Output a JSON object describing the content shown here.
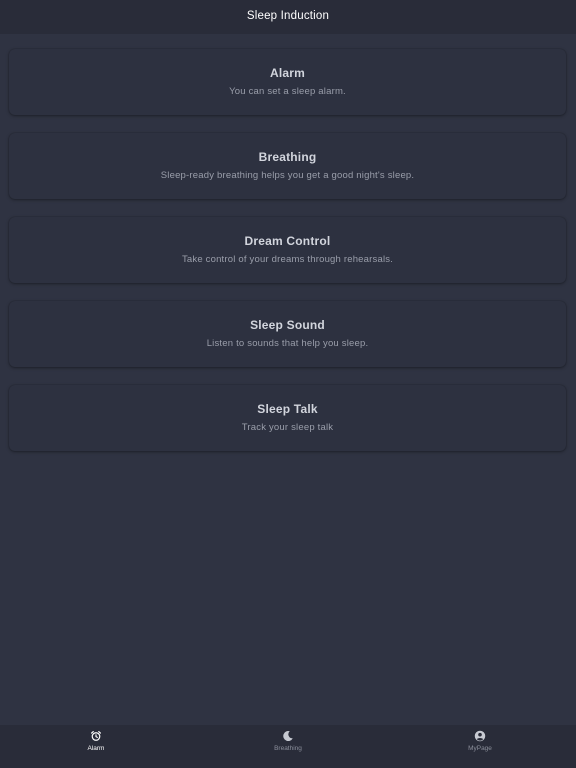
{
  "header": {
    "title": "Sleep Induction"
  },
  "cards": [
    {
      "title": "Alarm",
      "description": "You can set a sleep alarm."
    },
    {
      "title": "Breathing",
      "description": "Sleep-ready breathing helps you get a good night's sleep."
    },
    {
      "title": "Dream Control",
      "description": "Take control of your dreams through rehearsals."
    },
    {
      "title": "Sleep Sound",
      "description": "Listen to sounds that help you sleep."
    },
    {
      "title": "Sleep Talk",
      "description": "Track your sleep talk"
    }
  ],
  "tabs": [
    {
      "label": "Alarm",
      "icon": "alarm-clock-icon",
      "active": true
    },
    {
      "label": "Breathing",
      "icon": "moon-icon",
      "active": false
    },
    {
      "label": "MyPage",
      "icon": "user-circle-icon",
      "active": false
    }
  ],
  "colors": {
    "background": "#2f3342",
    "header": "#292c39",
    "card": "#2d3140",
    "active_tab": "#ffffff",
    "inactive_tab": "#8b8f9b"
  }
}
